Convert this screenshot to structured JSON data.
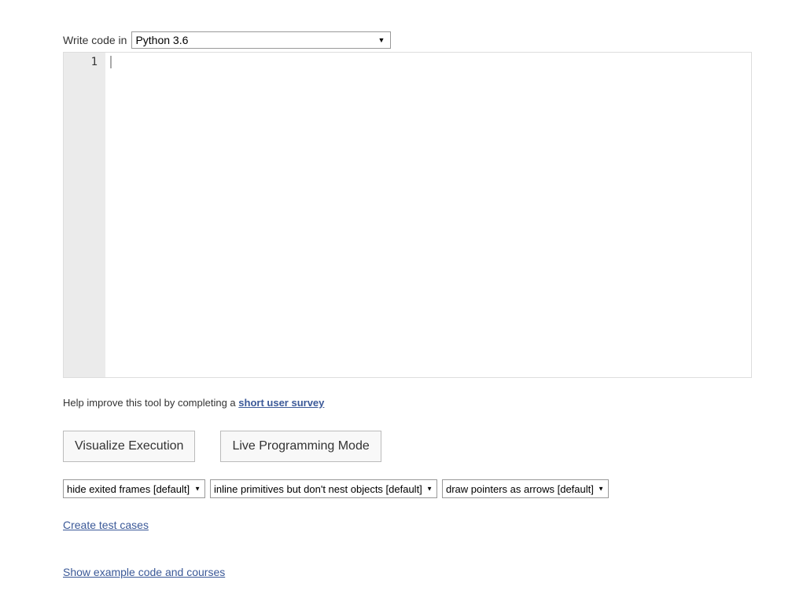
{
  "lang": {
    "label": "Write code in",
    "selected": "Python 3.6"
  },
  "editor": {
    "line_number": "1"
  },
  "help": {
    "prefix": "Help improve this tool by completing a ",
    "link_text": "short user survey"
  },
  "buttons": {
    "visualize": "Visualize Execution",
    "live": "Live Programming Mode"
  },
  "options": {
    "frames": "hide exited frames [default]",
    "primitives": "inline primitives but don't nest objects [default]",
    "pointers": "draw pointers as arrows [default]"
  },
  "links": {
    "create_tests": "Create test cases",
    "show_examples": "Show example code and courses"
  }
}
